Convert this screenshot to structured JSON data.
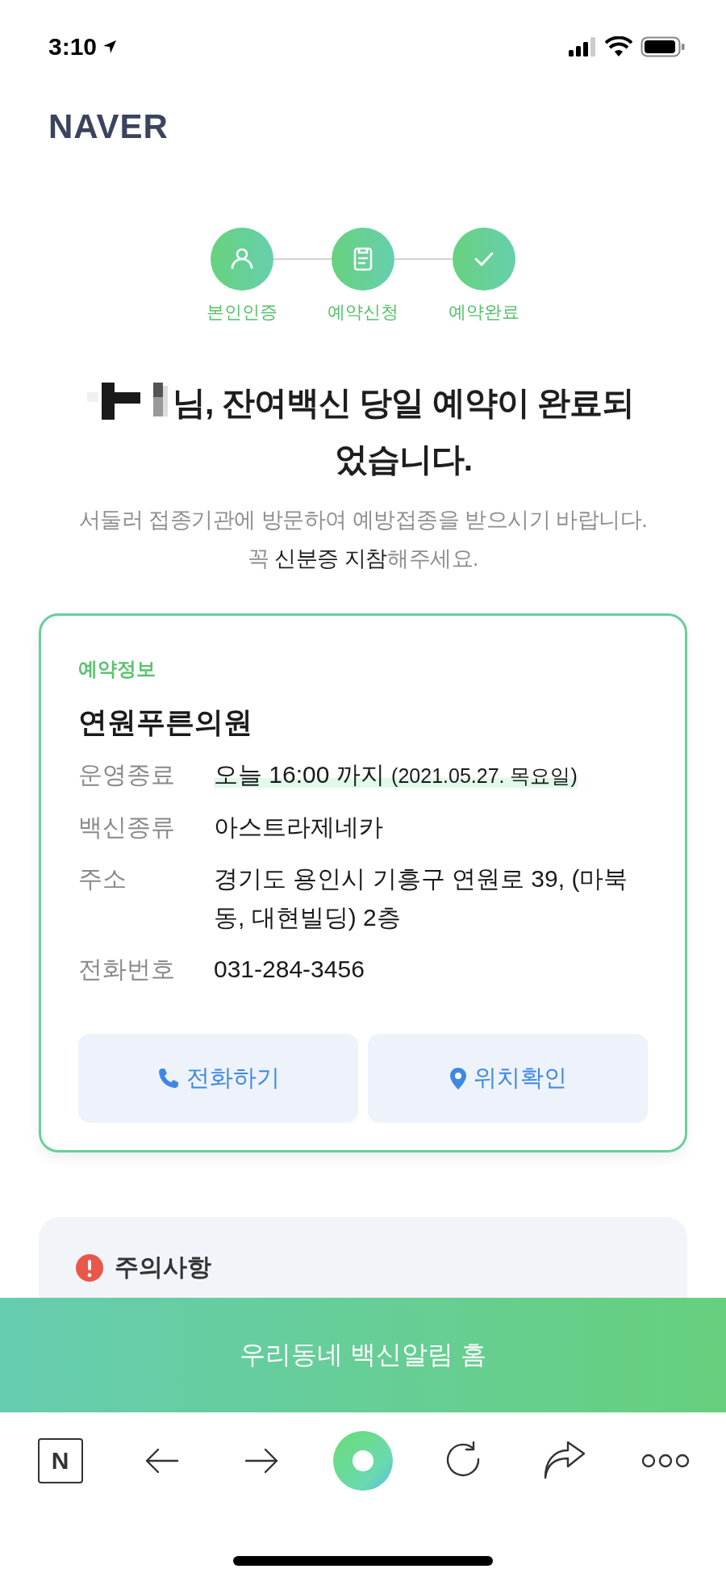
{
  "status_bar": {
    "time": "3:10"
  },
  "logo": "NAVER",
  "steps": [
    {
      "label": "본인인증",
      "kind": "person",
      "done": true
    },
    {
      "label": "예약신청",
      "kind": "form",
      "done": true
    },
    {
      "label": "예약완료",
      "kind": "check",
      "done": true
    }
  ],
  "headline": {
    "name_redacted": true,
    "text": "님, 잔여백신 당일 예약이 완료되었습니다."
  },
  "notice": "서둘러 접종기관에 방문하여 예방접종을 받으시기 바랍니다. 꼭 **신분증 지참**해주세요.",
  "reservation": {
    "section_title": "예약정보",
    "clinic": "연원푸른의원",
    "rows": [
      {
        "label": "운영종료",
        "value": "오늘 16:00 까지",
        "note": "(2021.05.27. 목요일)",
        "highlighted": true
      },
      {
        "label": "백신종류",
        "value": "아스트라제네카",
        "highlighted": false
      },
      {
        "label": "주소",
        "value": "경기도 용인시 기흥구 연원로 39, (마북동, 대현빌딩) 2층",
        "highlighted": false
      },
      {
        "label": "전화번호",
        "value": "031-284-3456",
        "highlighted": false
      }
    ],
    "buttons": [
      {
        "label": "전화하기",
        "kind": "phone"
      },
      {
        "label": "위치확인",
        "kind": "pin"
      }
    ]
  },
  "caution": {
    "title": "주의사항"
  },
  "home_button": "우리동네 백신알림 홈",
  "toolbar": [
    {
      "kind": "naver",
      "label": "N"
    },
    {
      "kind": "back"
    },
    {
      "kind": "forward"
    },
    {
      "kind": "home"
    },
    {
      "kind": "reload"
    },
    {
      "kind": "share"
    },
    {
      "kind": "more"
    }
  ]
}
